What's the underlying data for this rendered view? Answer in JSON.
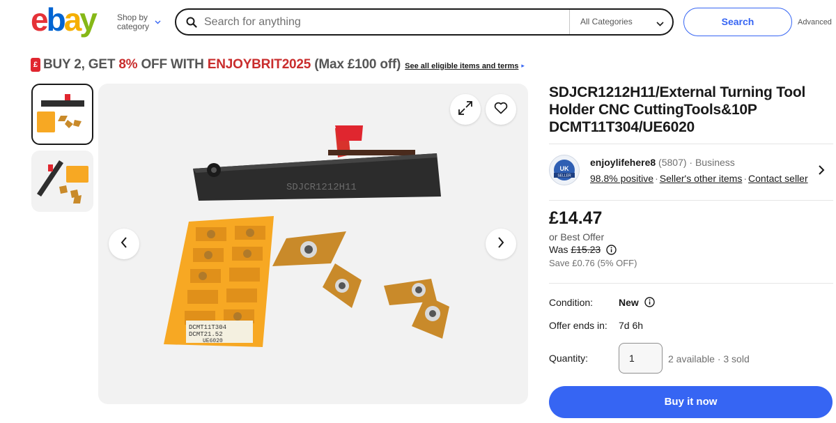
{
  "header": {
    "logo_text": "ebay",
    "logo_colors": [
      "#e53238",
      "#0064d2",
      "#f5af02",
      "#86b817"
    ],
    "shop_by_line1": "Shop by",
    "shop_by_line2": "category",
    "search_placeholder": "Search for anything",
    "category_label": "All Categories",
    "search_button": "Search",
    "advanced_link": "Advanced"
  },
  "promo": {
    "tag_icon": "£",
    "part1": "BUY 2, GET ",
    "percent": "8%",
    "part2": " OFF WITH ",
    "code": "ENJOYBRIT2025",
    "part3": " (Max £100 off)",
    "link": "See all eligible items and terms",
    "link_arrow": "▸"
  },
  "gallery": {
    "tool_label": "SDJCR1212H11",
    "insert_box_label_1": "DCMT11T304",
    "insert_box_label_2": "DCMT21.52",
    "insert_box_label_3": "UE6020",
    "icons": [
      "expand-icon",
      "heart-icon",
      "chevron-left-icon",
      "chevron-right-icon"
    ]
  },
  "listing": {
    "title": "SDJCR1212H11/External Turning Tool Holder CNC CuttingTools&10P DCMT11T304/UE6020",
    "seller": {
      "badge_text": "UK",
      "badge_subtext": "SELLER",
      "name": "enjoylifehere8",
      "feedback_count": "(5807)",
      "type": "· Business",
      "positive": "98.8% positive",
      "other_items": "Seller's other items",
      "contact": "Contact seller",
      "separator": "·"
    },
    "price": "£14.47",
    "best_offer": "or Best Offer",
    "was_label": "Was ",
    "was_price": "£15.23",
    "save": "Save £0.76 (5% OFF)",
    "condition_label": "Condition:",
    "condition_value": "New",
    "offer_ends_label": "Offer ends in:",
    "offer_ends_value": "7d 6h",
    "quantity_label": "Quantity:",
    "quantity_value": "1",
    "availability": "2 available · 3 sold",
    "buy_button": "Buy it now"
  },
  "colors": {
    "accent_blue": "#3665f3",
    "promo_red": "#c92d2d",
    "text": "#191919",
    "tool_red": "#e0262f",
    "insert_gold": "#c98a2a",
    "tray_orange": "#f7a823"
  }
}
